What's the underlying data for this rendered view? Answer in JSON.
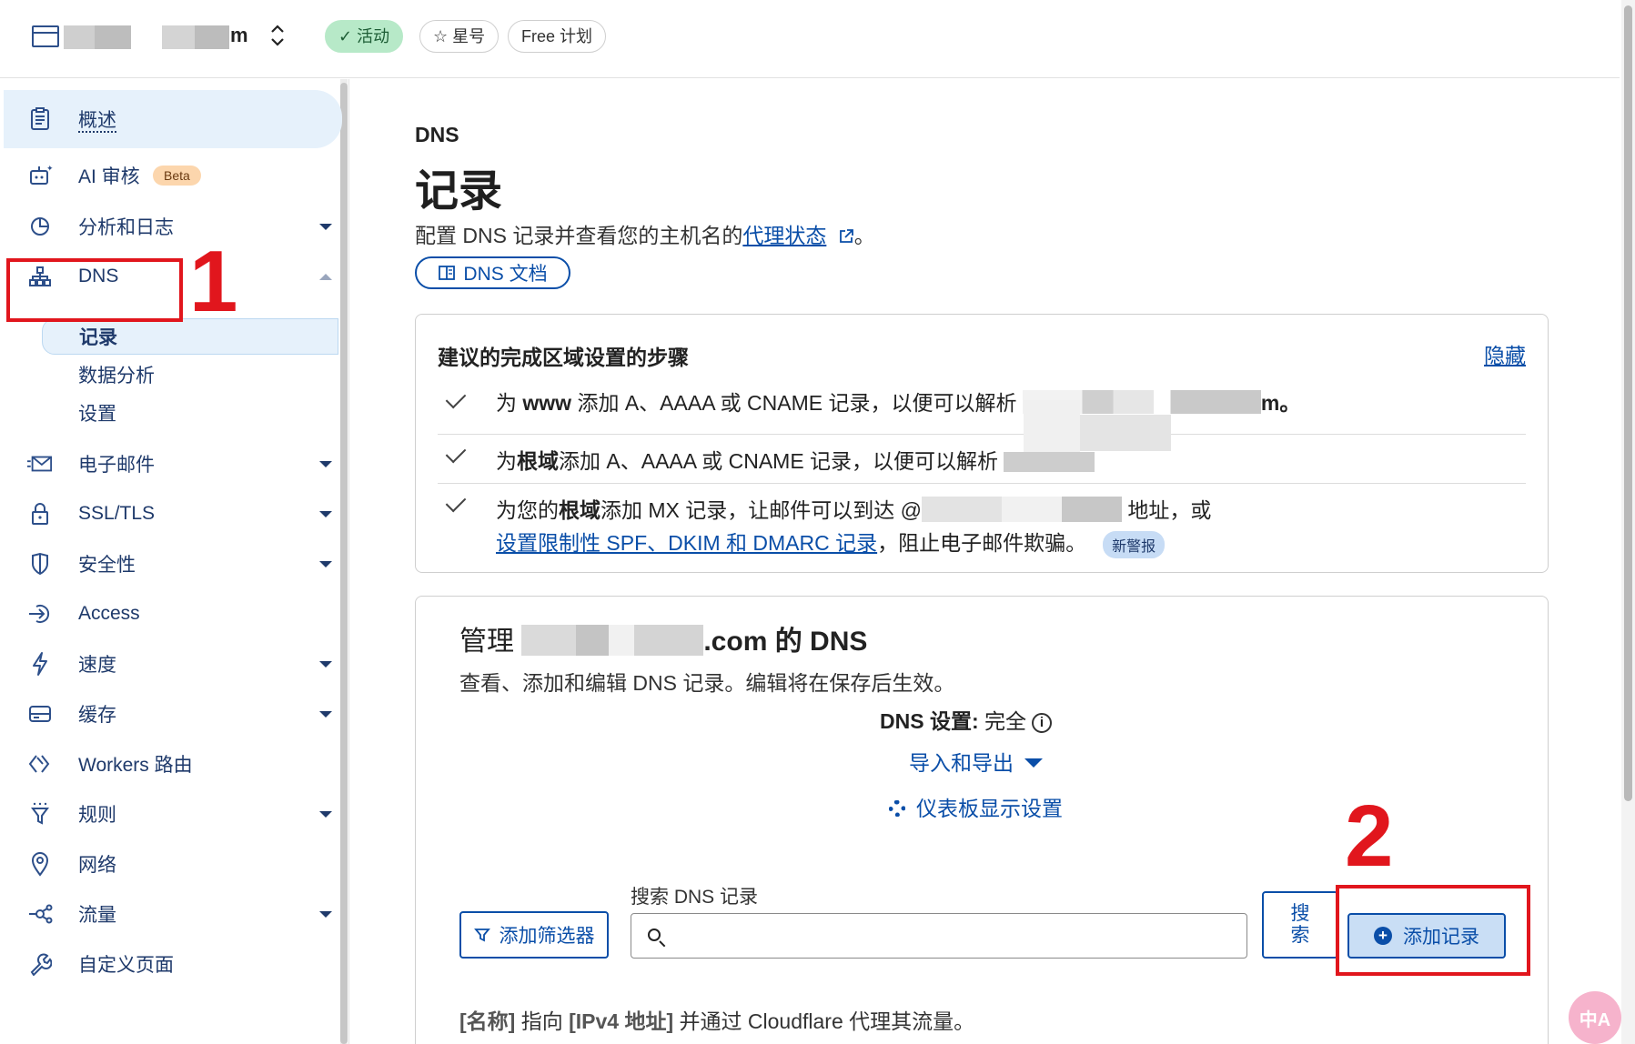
{
  "topbar": {
    "site_suffix": "m",
    "pills": {
      "active": "活动",
      "star": "星号",
      "plan": "Free 计划"
    }
  },
  "sidebar": {
    "items": [
      {
        "label": "概述",
        "icon": "clipboard-icon"
      },
      {
        "label": "AI 审核",
        "icon": "robot-icon",
        "badge": "Beta"
      },
      {
        "label": "分析和日志",
        "icon": "pie-chart-icon"
      },
      {
        "label": "DNS",
        "icon": "sitemap-icon"
      },
      {
        "label": "电子邮件",
        "icon": "email-icon"
      },
      {
        "label": "SSL/TLS",
        "icon": "lock-icon"
      },
      {
        "label": "安全性",
        "icon": "shield-icon"
      },
      {
        "label": "Access",
        "icon": "access-icon"
      },
      {
        "label": "速度",
        "icon": "lightning-icon"
      },
      {
        "label": "缓存",
        "icon": "storage-icon"
      },
      {
        "label": "Workers 路由",
        "icon": "workers-icon"
      },
      {
        "label": "规则",
        "icon": "funnel-icon"
      },
      {
        "label": "网络",
        "icon": "location-icon"
      },
      {
        "label": "流量",
        "icon": "network-icon"
      },
      {
        "label": "自定义页面",
        "icon": "wrench-icon"
      }
    ],
    "dns_sub": [
      "记录",
      "数据分析",
      "设置"
    ]
  },
  "annotations": {
    "one": "1",
    "two": "2"
  },
  "main": {
    "crumb": "DNS",
    "title": "记录",
    "desc_prefix": "配置 DNS 记录并查看您的主机名的",
    "desc_link": "代理状态",
    "desc_suffix": "。",
    "doc_button": "DNS 文档"
  },
  "steps_card": {
    "heading": "建议的完成区域设置的步骤",
    "hide": "隐藏",
    "step1": {
      "a": "为 ",
      "b": "www",
      "c": " 添加 A、AAAA 或 CNAME 记录，以便可以解析 ",
      "d": "m。"
    },
    "step2": {
      "a": "为",
      "b": "根域",
      "c": "添加 A、AAAA 或 CNAME 记录，以便可以解析 "
    },
    "step3": {
      "a": "为您的",
      "b": "根域",
      "c": "添加 MX 记录，让邮件可以到达 @",
      "d": " 地址，或",
      "link": "设置限制性 SPF、DKIM 和 DMARC 记录",
      "e": "，阻止电子邮件欺骗。",
      "badge": "新警报"
    }
  },
  "manage_card": {
    "title_prefix": "管理 ",
    "title_suffix": ".com 的 DNS",
    "desc": "查看、添加和编辑 DNS 记录。编辑将在保存后生效。",
    "dns_setting_label": "DNS 设置:",
    "dns_setting_value": "完全",
    "import_export": "导入和导出",
    "dashboard_settings": "仪表板显示设置",
    "filter_button": "添加筛选器",
    "search_label": "搜索 DNS 记录",
    "search_button": "搜索",
    "add_button": "添加记录",
    "hint_name": "[名称]",
    "hint_mid": " 指向 ",
    "hint_ip": "[IPv4 地址]",
    "hint_tail": " 并通过 Cloudflare 代理其流量。"
  },
  "translate_fab": "中A",
  "colors": {
    "accent": "#0a4ea8",
    "annotation": "#e1161d",
    "active_pill": "#b7e9c8"
  }
}
